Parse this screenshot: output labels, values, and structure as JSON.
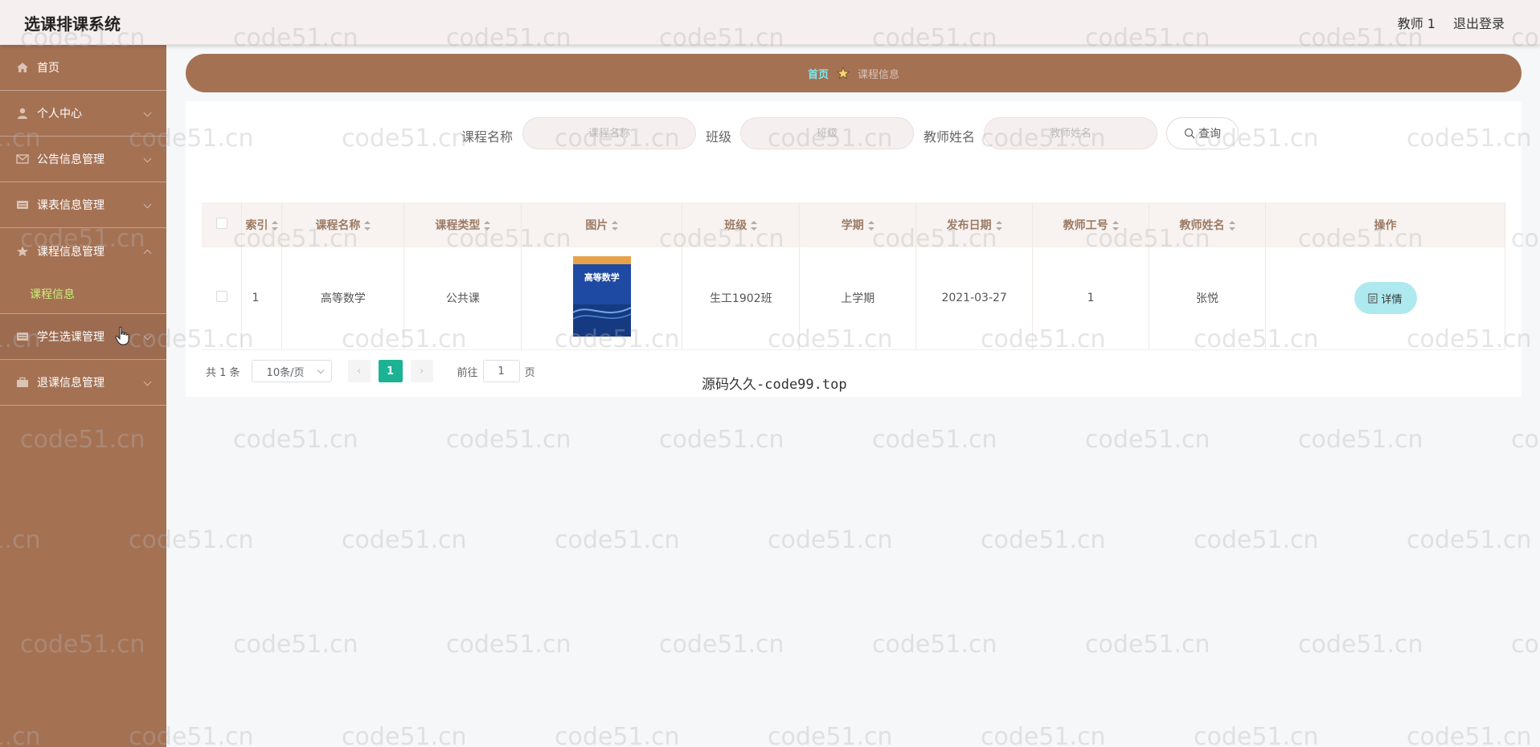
{
  "app": {
    "title": "选课排课系统"
  },
  "header": {
    "user": "教师 1",
    "logout": "退出登录"
  },
  "sidebar": {
    "items": [
      {
        "label": "首页",
        "icon": "home-icon"
      },
      {
        "label": "个人中心",
        "icon": "user-icon"
      },
      {
        "label": "公告信息管理",
        "icon": "mail-icon"
      },
      {
        "label": "课表信息管理",
        "icon": "list-icon"
      },
      {
        "label": "课程信息管理",
        "icon": "star-icon",
        "sub": [
          {
            "label": "课程信息"
          }
        ]
      },
      {
        "label": "学生选课管理",
        "icon": "list-icon"
      },
      {
        "label": "退课信息管理",
        "icon": "briefcase-icon"
      }
    ]
  },
  "breadcrumb": {
    "home": "首页",
    "current": "课程信息"
  },
  "search": {
    "course_label": "课程名称",
    "course_placeholder": "课程名称",
    "class_label": "班级",
    "class_placeholder": "班级",
    "teacher_label": "教师姓名",
    "teacher_placeholder": "教师姓名",
    "button": "查询"
  },
  "table": {
    "columns": [
      "索引",
      "课程名称",
      "课程类型",
      "图片",
      "班级",
      "学期",
      "发布日期",
      "教师工号",
      "教师姓名",
      "操作"
    ],
    "rows": [
      {
        "index": "1",
        "course": "高等数学",
        "type": "公共课",
        "image_title": "高等数学",
        "class": "生工1902班",
        "term": "上学期",
        "date": "2021-03-27",
        "teacher_id": "1",
        "teacher_name": "张悦",
        "action": "详情"
      }
    ]
  },
  "pagination": {
    "total": "共 1 条",
    "page_size": "10条/页",
    "current": "1",
    "goto_prefix": "前往",
    "goto_value": "1",
    "goto_suffix": "页",
    "prev": "‹",
    "next": "›"
  },
  "overlay_text": "源码久久-code99.top",
  "watermark": "code51.cn",
  "colors": {
    "sidebar": "#a57153",
    "accent": "#1bb394",
    "submenu_active": "#c8f07a",
    "detail_button": "#aee9ef"
  }
}
